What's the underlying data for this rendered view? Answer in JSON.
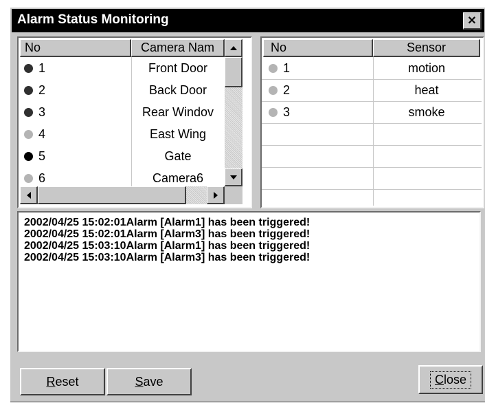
{
  "window": {
    "title": "Alarm Status Monitoring",
    "close_glyph": "✕"
  },
  "cameras": {
    "headers": {
      "no": "No",
      "name": "Camera Nam"
    },
    "rows": [
      {
        "no": "1",
        "name": "Front Door",
        "dot": "#303030"
      },
      {
        "no": "2",
        "name": "Back Door",
        "dot": "#303030"
      },
      {
        "no": "3",
        "name": "Rear Windov",
        "dot": "#303030"
      },
      {
        "no": "4",
        "name": "East Wing",
        "dot": "#b4b4b4"
      },
      {
        "no": "5",
        "name": "Gate",
        "dot": "#000000"
      },
      {
        "no": "6",
        "name": "Camera6",
        "dot": "#b4b4b4"
      }
    ]
  },
  "sensors": {
    "headers": {
      "no": "No",
      "name": "Sensor"
    },
    "rows": [
      {
        "no": "1",
        "name": "motion",
        "dot": "#b4b4b4"
      },
      {
        "no": "2",
        "name": "heat",
        "dot": "#b4b4b4"
      },
      {
        "no": "3",
        "name": "smoke",
        "dot": "#b4b4b4"
      }
    ]
  },
  "log": {
    "lines": [
      "2002/04/25 15:02:01Alarm [Alarm1] has been triggered!",
      "2002/04/25 15:02:01Alarm [Alarm3] has been triggered!",
      "2002/04/25 15:03:10Alarm [Alarm1] has been triggered!",
      "2002/04/25 15:03:10Alarm [Alarm3] has been triggered!"
    ]
  },
  "buttons": {
    "reset": {
      "mnemonic": "R",
      "rest": "eset"
    },
    "save": {
      "mnemonic": "S",
      "rest": "ave"
    },
    "close": {
      "mnemonic": "C",
      "rest": "lose"
    }
  }
}
